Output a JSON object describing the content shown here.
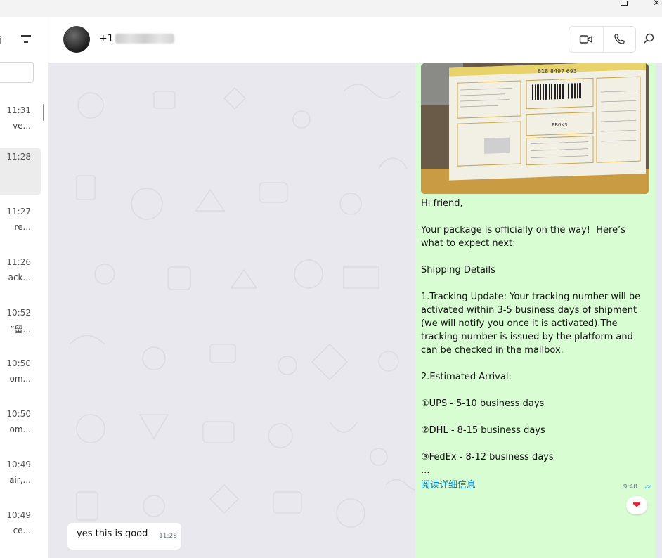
{
  "sidebar": {
    "chats": [
      {
        "time": "11:31",
        "preview": "ve..."
      },
      {
        "time": "11:28",
        "preview": ""
      },
      {
        "time": "11:27",
        "preview": "re..."
      },
      {
        "time": "11:26",
        "preview": "ack..."
      },
      {
        "time": "10:52",
        "preview": "”留..."
      },
      {
        "time": "10:50",
        "preview": "om..."
      },
      {
        "time": "10:50",
        "preview": "om..."
      },
      {
        "time": "10:49",
        "preview": "air,..."
      },
      {
        "time": "10:49",
        "preview": "ce..."
      }
    ]
  },
  "header": {
    "contact_name_prefix": "+1"
  },
  "messages": {
    "outgoing": {
      "text": "Hi friend,\n\nYour package is officially on the way!  Here’s what to expect next:\n\nShipping Details\n\n1.Tracking Update: Your tracking number will be activated within 3-5 business days of shipment (we will notify you once it is activated).The tracking number is issued by the platform and can be checked in the mailbox.\n\n2.Estimated Arrival:\n\n①UPS - 5-10 business days\n\n②DHL - 8-15 business days\n\n③FedEx - 8-12 business days\n...",
      "read_more": "阅读详细信息",
      "time": "9:48",
      "photo": {
        "tracking_number": "818 8497 693",
        "box_label": "PB0K3"
      }
    },
    "reaction": "❤",
    "incoming": {
      "text": "yes this is good",
      "time": "11:28"
    }
  },
  "colors": {
    "outgoing_bubble": "#d9fdd3",
    "chat_background": "#eae8ef",
    "link": "#027eb5",
    "read_ticks": "#53bdeb"
  },
  "icons": [
    "filter-icon",
    "video-call-icon",
    "phone-call-icon",
    "search-icon",
    "heart-reaction-icon",
    "double-check-icon"
  ]
}
